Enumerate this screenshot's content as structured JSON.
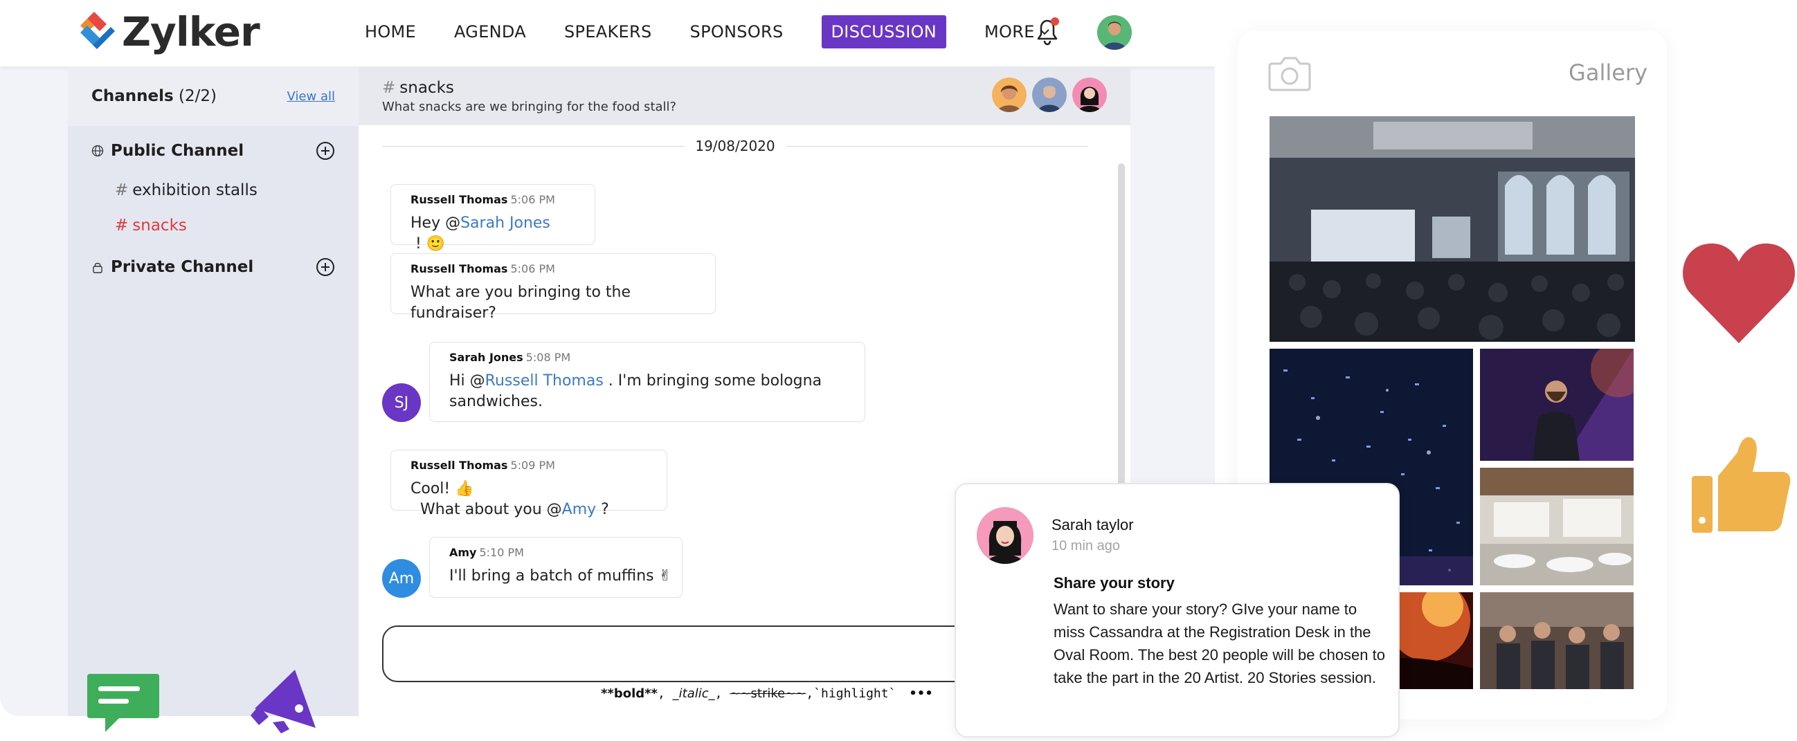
{
  "brand": {
    "name": "Zylker"
  },
  "nav": {
    "items": [
      "HOME",
      "AGENDA",
      "SPEAKERS",
      "SPONSORS",
      "DISCUSSION"
    ],
    "more": "MORE"
  },
  "sidebar": {
    "title": "Channels",
    "count": "(2/2)",
    "view_all": "View all",
    "public_label": "Public Channel",
    "private_label": "Private Channel",
    "channels": [
      {
        "hash": "#",
        "name": "exhibition stalls"
      },
      {
        "hash": "#",
        "name": "snacks"
      }
    ]
  },
  "chat": {
    "hash": "#",
    "channel": "snacks",
    "topic": "What snacks are we bringing for the food stall?",
    "date": "19/08/2020",
    "messages": [
      {
        "author": "Russell Thomas",
        "time": "5:06 PM",
        "pre": "Hey @",
        "mention": "Sarah Jones",
        "post": " ! ",
        "emoji": "🙂"
      },
      {
        "author": "Russell Thomas",
        "time": "5:06 PM",
        "text": "What are you bringing to the fundraiser?"
      },
      {
        "author": "Sarah Jones",
        "time": "5:08 PM",
        "initials": "SJ",
        "pre": "Hi @",
        "mention": "Russell Thomas",
        "post1": " . I'm bringing some bologna",
        "post2": "sandwiches."
      },
      {
        "author": "Russell Thomas",
        "time": "5:09 PM",
        "pre": "Cool! ",
        "emoji": "👍",
        "pre2": "  What about you @",
        "mention": "Amy",
        "post": " ?"
      },
      {
        "author": "Amy",
        "time": "5:10 PM",
        "initials": "Am",
        "text": "I'll bring a batch of muffins ",
        "emoji": "✌"
      }
    ],
    "format_hint": {
      "bold": "**bold**",
      "sep1": ", ",
      "italic": "_italic_",
      "sep2": ", ",
      "strike": "~~strike~~",
      "sep3": ",",
      "code": "`highlight`",
      "more": "•••"
    }
  },
  "gallery": {
    "title": "Gallery"
  },
  "notification": {
    "name": "Sarah taylor",
    "time": "10 min ago",
    "heading": "Share your story",
    "body": "Want to share your story? GIve your name to miss Cassandra at the Registration Desk in the Oval Room. The best 20 people will be chosen to take the part in the 20 Artist. 20 Stories session."
  },
  "icons": {
    "bell": "bell-icon",
    "globe": "globe-icon",
    "lock": "lock-icon",
    "plus": "plus-circle-icon",
    "camera": "camera-icon",
    "heart": "heart-icon",
    "thumb": "thumbs-up-icon",
    "chat": "chat-bubble-icon",
    "megaphone": "megaphone-icon"
  },
  "colors": {
    "accent": "#6a36c5",
    "active_channel": "#e0393e",
    "mention": "#3b7ac4",
    "heart": "#c8414d",
    "thumb": "#f0b24a",
    "chat_icon": "#3fae5a"
  }
}
